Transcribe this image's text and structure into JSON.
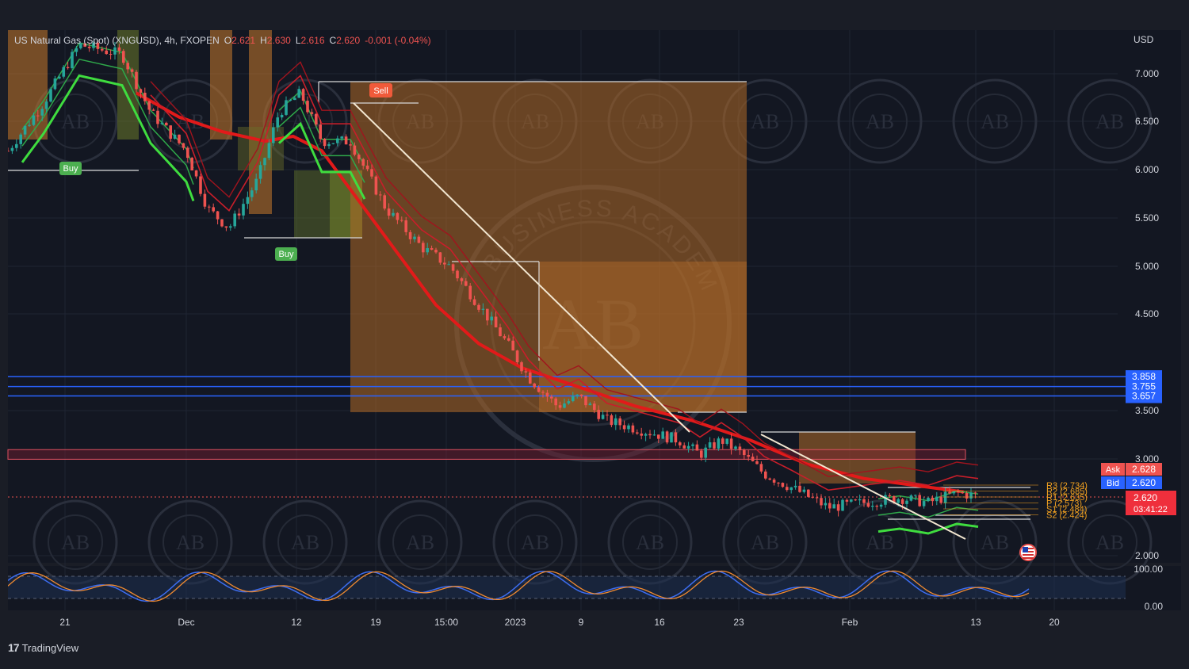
{
  "window": {
    "symbol_title": "US Natural Gas (Spot) (XNGUSD), 4h, FXOPEN",
    "ohlc": {
      "o_label": "O",
      "o": "2.621",
      "h_label": "H",
      "h": "2.630",
      "l_label": "L",
      "l": "2.616",
      "c_label": "C",
      "c": "2.620",
      "change": "-0.001 (-0.04%)"
    },
    "currency": "USD",
    "brand": "TradingView",
    "watermark_text": "BUSINESS ACADEMY",
    "watermark_mark": "AB"
  },
  "markers": {
    "sell": "Sell",
    "buy": "Buy"
  },
  "quote": {
    "ask_label": "Ask",
    "ask": "2.628",
    "bid_label": "Bid",
    "bid": "2.620",
    "last": "2.620",
    "countdown": "03:41:22"
  },
  "pivots": [
    {
      "label": "R3 (2.734)",
      "value": 2.734
    },
    {
      "label": "R2 (2.685)",
      "value": 2.685
    },
    {
      "label": "R1 (2.635)",
      "value": 2.635
    },
    {
      "label": "P (2.573)",
      "value": 2.573
    },
    {
      "label": "S1 (2.484)",
      "value": 2.484
    },
    {
      "label": "S2 (2.424)",
      "value": 2.424
    }
  ],
  "colors": {
    "background": "#1a1d26",
    "up": "#26a69a",
    "down": "#ef5350",
    "ma_red": "#e21a1a",
    "ma_green": "#3fdc3f",
    "zone_orange": "#c87a2c",
    "blue_line": "#2962ff",
    "pivot": "#f0a020"
  },
  "chart_data": {
    "type": "line",
    "title": "US Natural Gas (Spot) (XNGUSD), 4h, FXOPEN",
    "y_axis": {
      "ticks": [
        "7.000",
        "6.500",
        "6.000",
        "5.500",
        "5.000",
        "4.500",
        "3.500",
        "3.000",
        "2.000"
      ],
      "ylim": [
        1.9,
        7.4
      ]
    },
    "x_axis": {
      "ticks": [
        "21",
        "Dec",
        "12",
        "19",
        "15:00",
        "2023",
        "9",
        "16",
        "23",
        "Feb",
        "13",
        "20"
      ]
    },
    "price_labels": [
      "3.858",
      "3.755",
      "3.657"
    ],
    "horizontal_lines": [
      3.858,
      3.755,
      3.657
    ],
    "resistance_zone": [
      3.0,
      3.1
    ],
    "series": [
      {
        "name": "price",
        "values": [
          [
            0,
            6.2
          ],
          [
            2.5,
            6.7
          ],
          [
            5,
            7.3
          ],
          [
            8,
            7.2
          ],
          [
            10,
            6.6
          ],
          [
            12.5,
            6.2
          ],
          [
            14,
            5.6
          ],
          [
            15.5,
            5.4
          ],
          [
            17.5,
            5.9
          ],
          [
            19,
            6.6
          ],
          [
            20.5,
            6.8
          ],
          [
            22,
            6.3
          ],
          [
            24,
            6.3
          ],
          [
            26.5,
            5.6
          ],
          [
            29,
            5.2
          ],
          [
            31,
            5.0
          ],
          [
            33,
            4.6
          ],
          [
            35,
            4.2
          ],
          [
            36.5,
            3.85
          ],
          [
            38.5,
            3.55
          ],
          [
            40,
            3.65
          ],
          [
            42,
            3.4
          ],
          [
            44.5,
            3.3
          ],
          [
            47,
            3.2
          ],
          [
            48.5,
            3.05
          ],
          [
            50,
            3.2
          ],
          [
            51.5,
            3.05
          ],
          [
            53,
            2.85
          ],
          [
            55,
            2.7
          ],
          [
            57.5,
            2.5
          ],
          [
            60,
            2.55
          ],
          [
            62.5,
            2.6
          ],
          [
            64.5,
            2.55
          ],
          [
            66.5,
            2.65
          ],
          [
            68,
            2.62
          ]
        ]
      },
      {
        "name": "ma",
        "values": [
          [
            9,
            6.8
          ],
          [
            12,
            6.55
          ],
          [
            15,
            6.4
          ],
          [
            18,
            6.3
          ],
          [
            20,
            6.35
          ],
          [
            22,
            6.2
          ],
          [
            24,
            5.8
          ],
          [
            26,
            5.4
          ],
          [
            28,
            5.0
          ],
          [
            30,
            4.6
          ],
          [
            33,
            4.2
          ],
          [
            36,
            3.95
          ],
          [
            40,
            3.75
          ],
          [
            44,
            3.55
          ],
          [
            48,
            3.4
          ],
          [
            52,
            3.2
          ],
          [
            56,
            2.95
          ],
          [
            60,
            2.8
          ],
          [
            64,
            2.72
          ],
          [
            67,
            2.66
          ]
        ]
      }
    ],
    "oscillator": {
      "axis_labels": [
        "100.00",
        "0.00"
      ]
    }
  }
}
